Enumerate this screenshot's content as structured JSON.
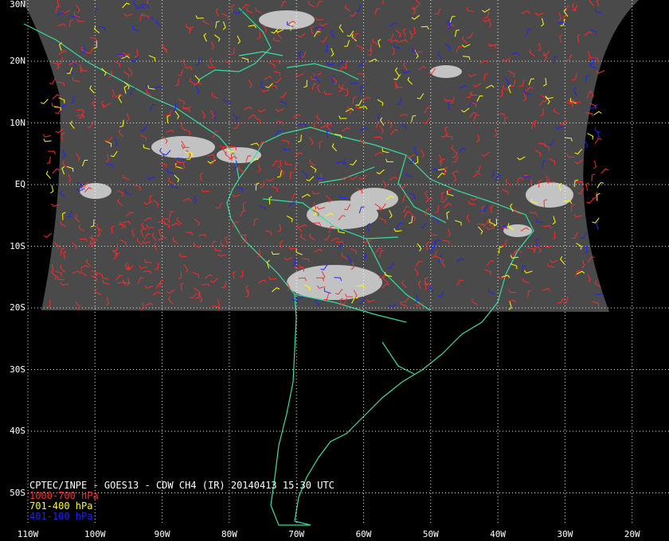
{
  "title": "CPTEC/INPE - GOES13 - CDW CH4 (IR) 20140413 15:30 UTC",
  "legend": [
    {
      "label": "1000-700 hPa",
      "color": "#ff2a2a"
    },
    {
      "label": "701-400 hPa",
      "color": "#ffff00"
    },
    {
      "label": "401-100 hPa",
      "color": "#2020ff"
    }
  ],
  "lat_labels": [
    "30N",
    "20N",
    "10N",
    "EQ",
    "10S",
    "20S",
    "30S",
    "40S",
    "50S"
  ],
  "lon_labels": [
    "110W",
    "100W",
    "90W",
    "80W",
    "70W",
    "60W",
    "50W",
    "40W",
    "30W",
    "20W"
  ],
  "colors": {
    "background": "#000000",
    "coastline": "#33e0a0",
    "grid": "#ffffff",
    "satellite_base": "#4a4a4a"
  },
  "map": {
    "projection": "cylindrical equidistant",
    "lon_range": [
      -110,
      -15
    ],
    "lat_range": [
      -55,
      30
    ],
    "grid_spacing_deg": 10,
    "satellite_coverage_lat": [
      -20,
      30
    ]
  }
}
